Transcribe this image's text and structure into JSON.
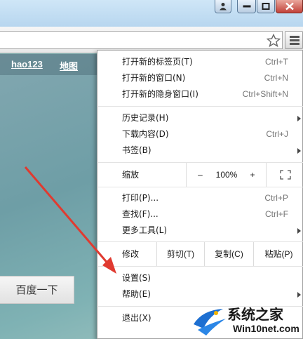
{
  "browser": {
    "nav_links": [
      "hao123",
      "地图"
    ],
    "page_button": "百度一下"
  },
  "menu": {
    "items": [
      {
        "label": "打开新的标签页(T)",
        "shortcut": "Ctrl+T"
      },
      {
        "label": "打开新的窗口(N)",
        "shortcut": "Ctrl+N"
      },
      {
        "label": "打开新的隐身窗口(I)",
        "shortcut": "Ctrl+Shift+N"
      },
      {
        "label": "历史记录(H)",
        "shortcut": ""
      },
      {
        "label": "下载内容(D)",
        "shortcut": "Ctrl+J"
      },
      {
        "label": "书签(B)",
        "shortcut": ""
      },
      {
        "label": "打印(P)...",
        "shortcut": "Ctrl+P"
      },
      {
        "label": "查找(F)...",
        "shortcut": "Ctrl+F"
      },
      {
        "label": "更多工具(L)",
        "shortcut": ""
      },
      {
        "label": "设置(S)",
        "shortcut": ""
      },
      {
        "label": "帮助(E)",
        "shortcut": ""
      },
      {
        "label": "退出(X)",
        "shortcut": ""
      }
    ],
    "zoom": {
      "label": "缩放",
      "minus": "–",
      "value": "100%",
      "plus": "+"
    },
    "edit": {
      "label": "修改",
      "cut": "剪切(T)",
      "copy": "复制(C)",
      "paste": "粘贴(P)"
    }
  },
  "watermark": {
    "title": "系统之家",
    "subtitle": "Win10net.com"
  }
}
